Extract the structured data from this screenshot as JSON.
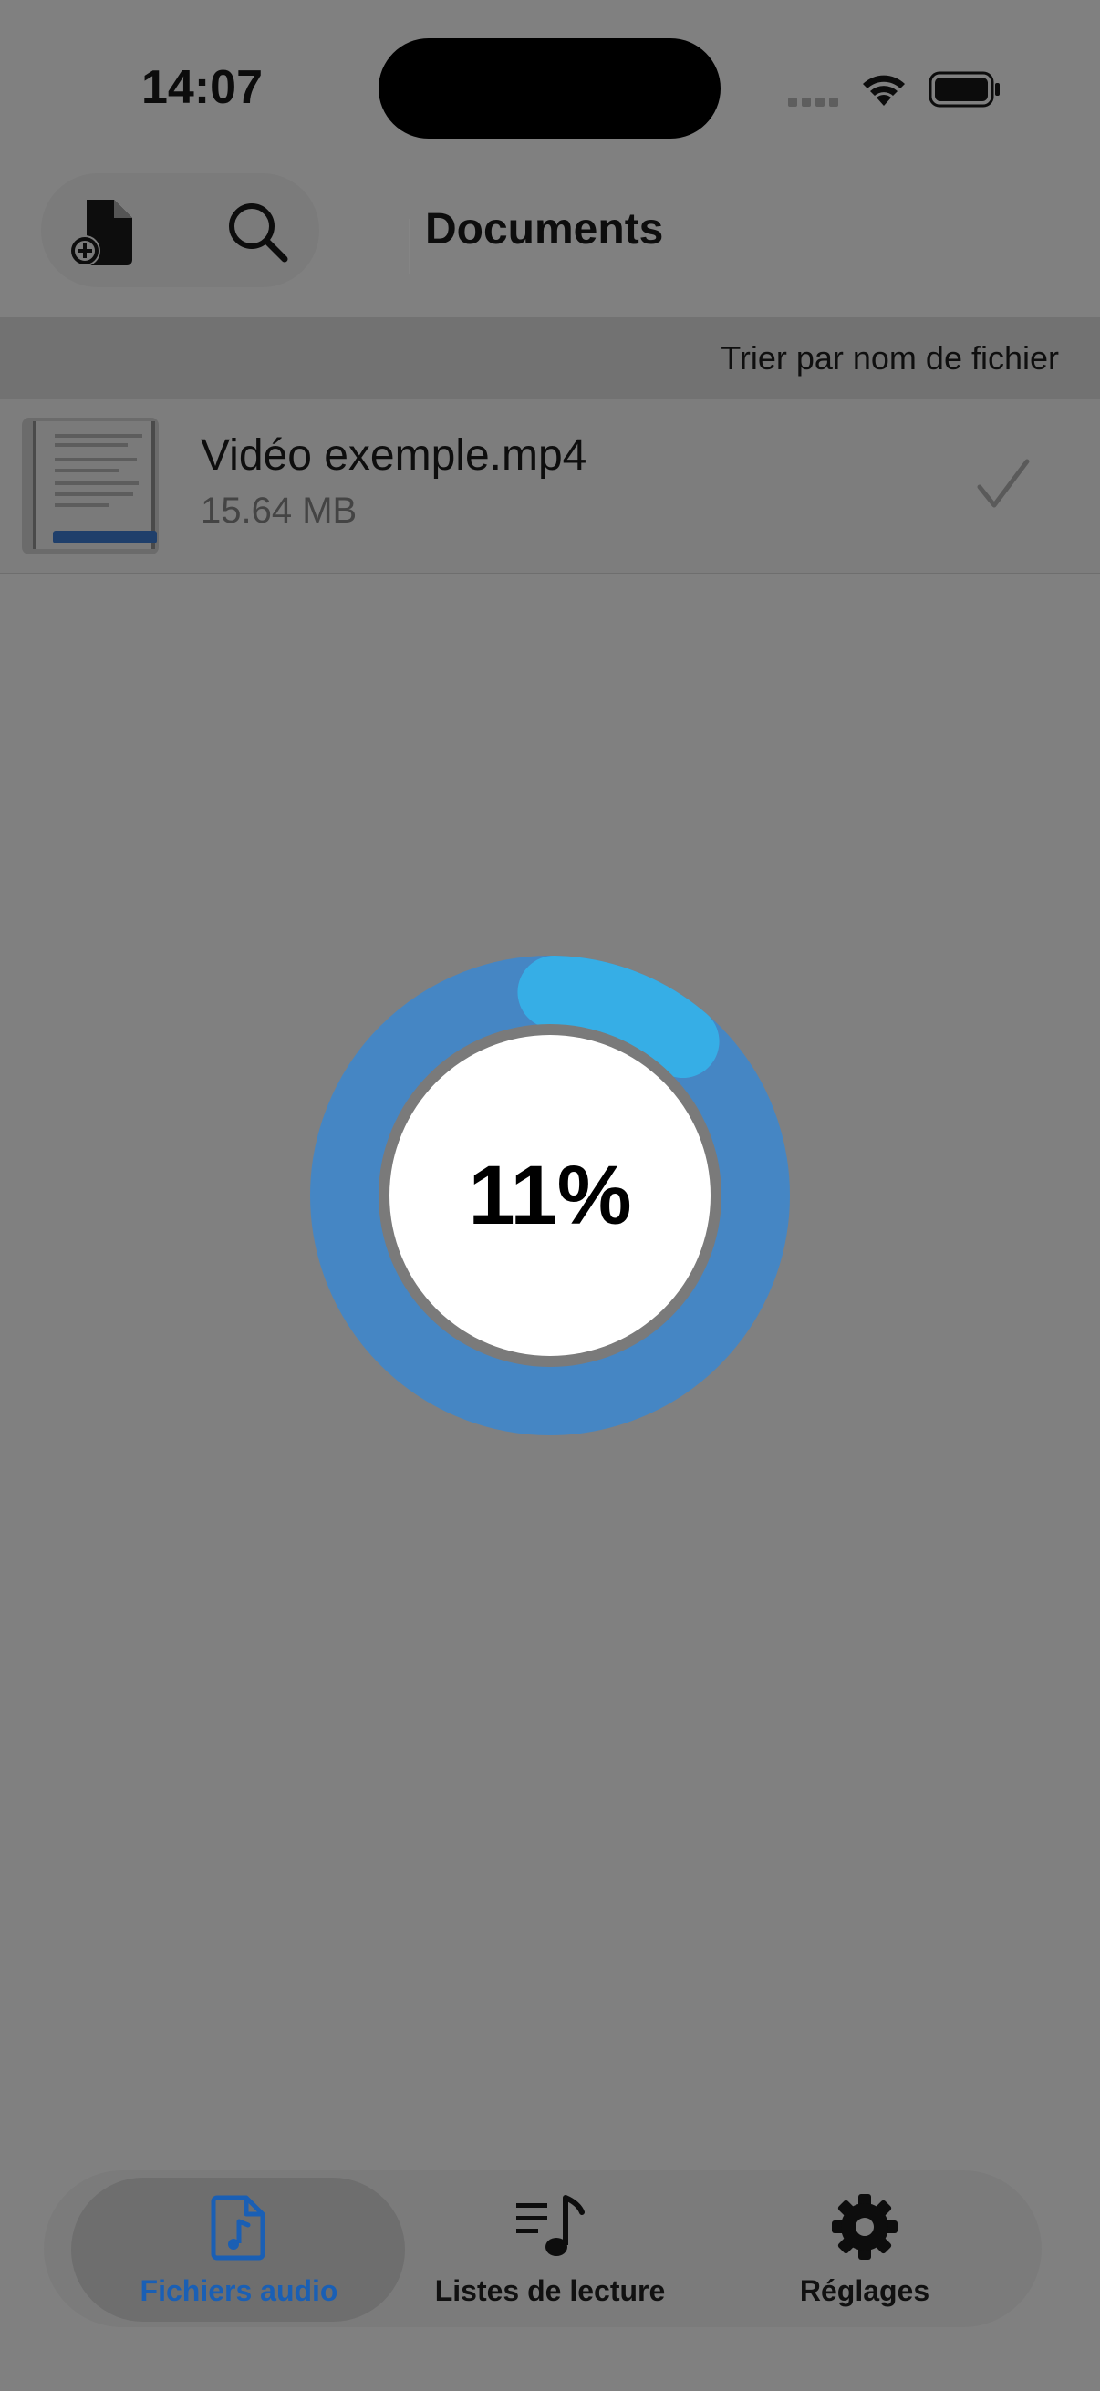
{
  "status_bar": {
    "time": "14:07"
  },
  "header": {
    "title": "Documents"
  },
  "sort": {
    "label": "Trier par nom de fichier"
  },
  "files": [
    {
      "name": "Vidéo exemple.mp4",
      "size": "15.64 MB",
      "selected": true
    }
  ],
  "progress": {
    "percent": 11,
    "label": "11%"
  },
  "tabs": [
    {
      "label": "Fichiers audio",
      "active": true
    },
    {
      "label": "Listes de lecture",
      "active": false
    },
    {
      "label": "Réglages",
      "active": false
    }
  ],
  "colors": {
    "accent": "#1a5fb4",
    "progress_track": "#4586c4",
    "progress_fill": "#36aee6"
  },
  "icons": {
    "new_document": "doc-plus-icon",
    "search": "search-icon",
    "checkmark": "checkmark-icon",
    "audio_file": "audio-file-icon",
    "playlist": "playlist-icon",
    "settings": "gear-icon"
  }
}
